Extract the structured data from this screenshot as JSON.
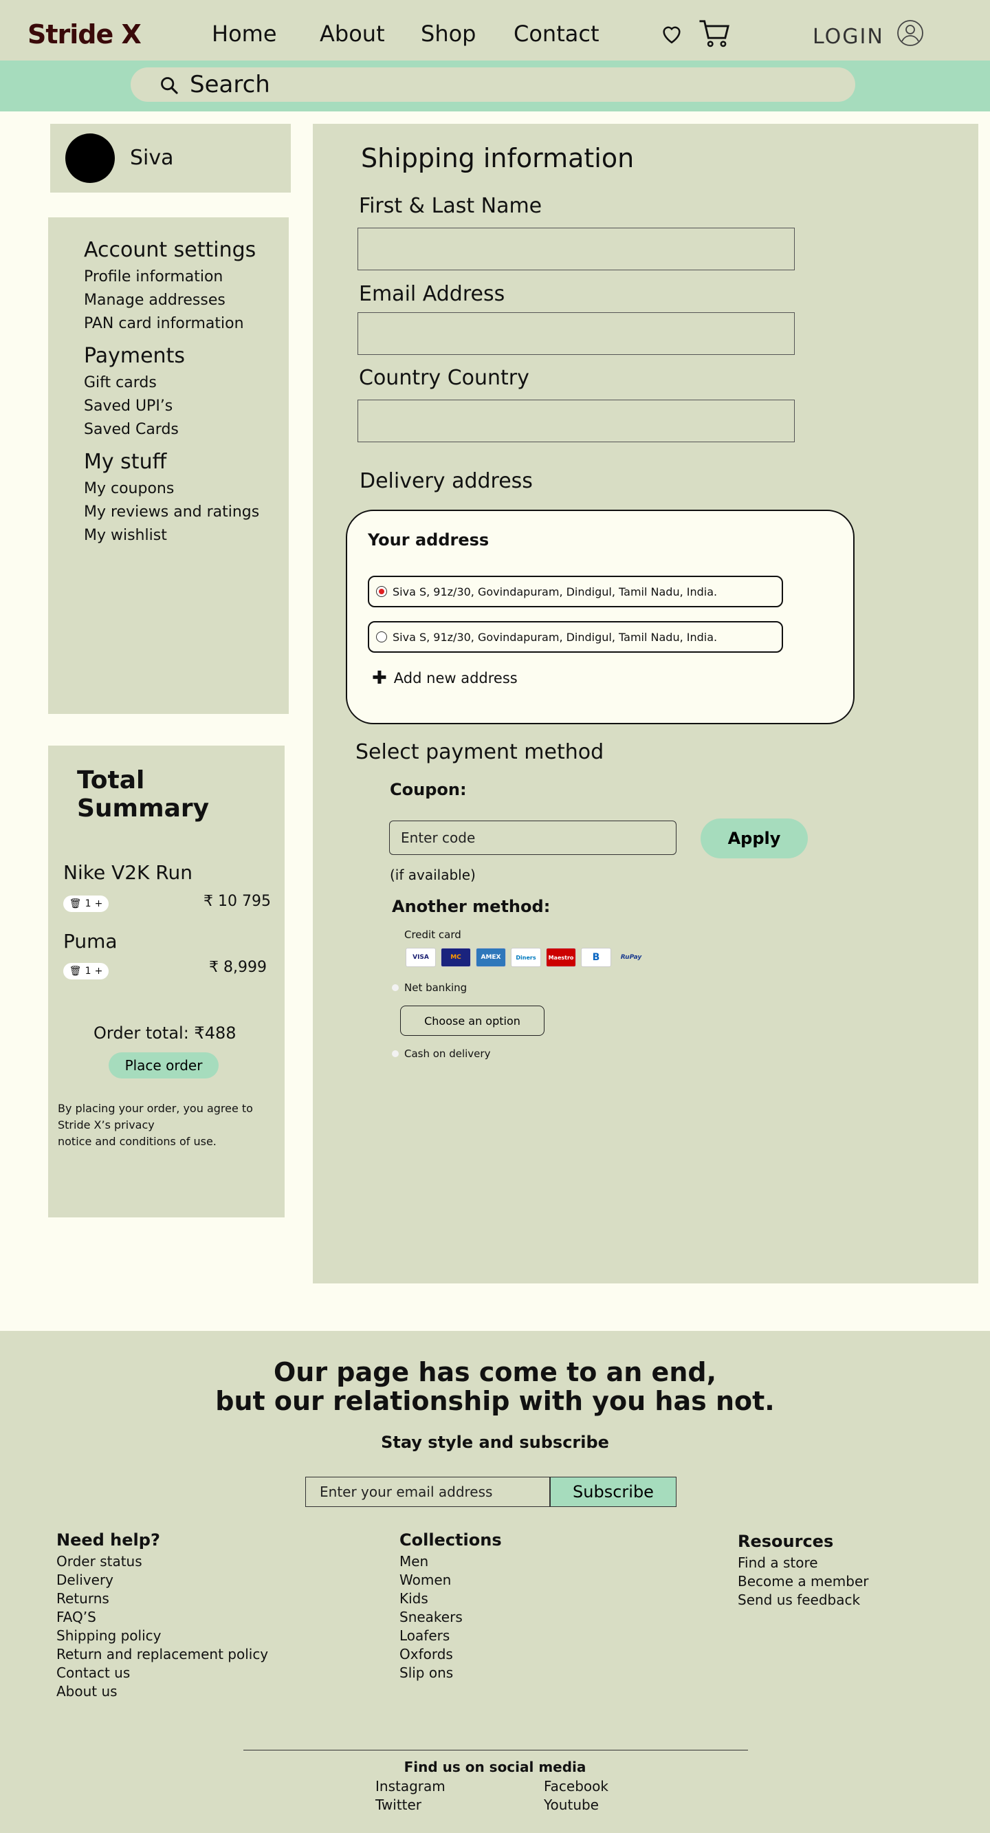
{
  "header": {
    "brand": "Stride X",
    "nav": [
      "Home",
      "About",
      "Shop",
      "Contact"
    ],
    "login_label": "LOGIN"
  },
  "search": {
    "placeholder": "Search"
  },
  "profile": {
    "name": "Siva"
  },
  "sidebar": {
    "sections": [
      {
        "title": "Account settings",
        "items": [
          "Profile information",
          "Manage addresses",
          "PAN card information"
        ]
      },
      {
        "title": "Payments",
        "items": [
          "Gift cards",
          "Saved UPI’s",
          "Saved Cards"
        ]
      },
      {
        "title": "My stuff",
        "items": [
          "My coupons",
          "My reviews and ratings",
          "My wishlist"
        ]
      }
    ]
  },
  "summary": {
    "title": "Total Summary",
    "products": [
      {
        "name": "Nike V2K Run",
        "qty": "1",
        "price": "₹ 10 795"
      },
      {
        "name": "Puma",
        "qty": "1",
        "price": "₹ 8,999"
      }
    ],
    "order_total": "Order total: ₹488",
    "place_order": "Place order",
    "terms_line1": "By placing your order, you agree to",
    "terms_line2": "Stride X’s privacy",
    "terms_line3": "notice and conditions of use."
  },
  "shipping": {
    "title": "Shipping information",
    "fields": [
      {
        "label": "First & Last Name",
        "value": ""
      },
      {
        "label": "Email Address",
        "value": ""
      },
      {
        "label": "Country Country",
        "value": ""
      }
    ],
    "delivery_label": "Delivery address",
    "address_title": "Your address",
    "addresses": [
      "Siva S, 91z/30, Govindapuram, Dindigul, Tamil Nadu, India.",
      "Siva S, 91z/30, Govindapuram, Dindigul, Tamil Nadu, India."
    ],
    "add_address": "Add new address"
  },
  "payment": {
    "title": "Select payment method",
    "coupon_label": "Coupon:",
    "coupon_placeholder": "Enter code",
    "apply": "Apply",
    "if_available": "(if available)",
    "another_method": "Another method:",
    "credit_card_label": "Credit card",
    "cards": [
      "VISA",
      "MC",
      "AMEX",
      "Diners",
      "Maestro",
      "B",
      "RuPay"
    ],
    "net_banking": "Net banking",
    "choose_option": "Choose an option",
    "cod": "Cash on delivery"
  },
  "footer": {
    "title_line1": "Our page has come to an end,",
    "title_line2": "but our relationship with you has not.",
    "subtitle": "Stay style and subscribe",
    "email_placeholder": "Enter your email address",
    "subscribe": "Subscribe",
    "columns": [
      {
        "title": "Need help?",
        "items": [
          "Order status",
          "Delivery",
          "Returns",
          "FAQ’S",
          "Shipping policy",
          "Return and replacement policy",
          "Contact us",
          "About us"
        ]
      },
      {
        "title": "Collections",
        "items": [
          "Men",
          "Women",
          "Kids",
          "Sneakers",
          "Loafers",
          "Oxfords",
          "Slip ons"
        ]
      },
      {
        "title": "Resources",
        "items": [
          "Find a store",
          "Become a member",
          "Send us feedback"
        ]
      }
    ],
    "social_title": "Find us on social media",
    "social": [
      "Instagram",
      "Facebook",
      "Twitter",
      "Youtube"
    ]
  },
  "colors": {
    "header_bg": "#D8DDC4",
    "accent": "#A6DCBD",
    "page_bg": "#FDFDF1",
    "brand": "#3A0A0A"
  }
}
